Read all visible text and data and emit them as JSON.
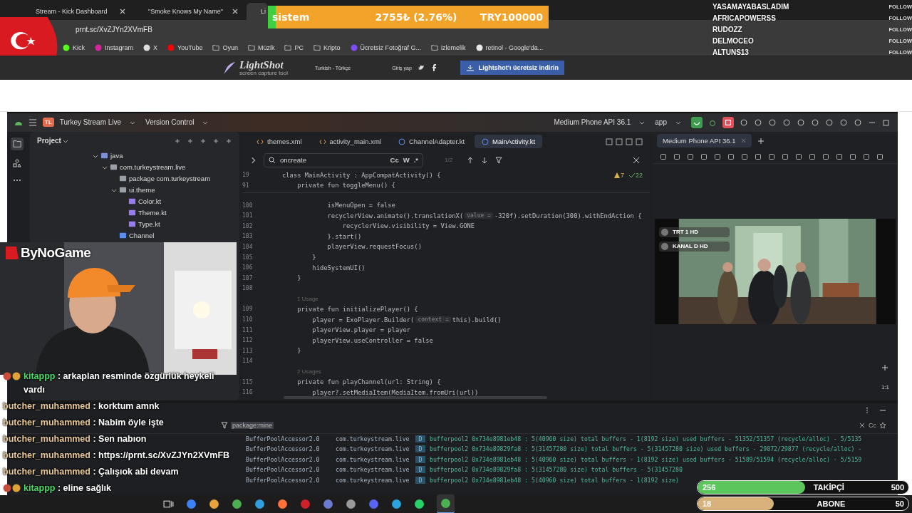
{
  "browser": {
    "tabs": [
      {
        "title": "Stream - Kick Dashboard",
        "selected": false
      },
      {
        "title": "\"Smoke Knows My Name\"",
        "selected": false
      },
      {
        "title": "Li",
        "selected": true
      }
    ],
    "address": "prnt.sc/XvZJYn2XVmFB",
    "bookmarks": [
      {
        "label": "Kick",
        "kind": "site",
        "color": "#53fc18"
      },
      {
        "label": "Instagram",
        "kind": "site",
        "color": "#d6249f"
      },
      {
        "label": "X",
        "kind": "site",
        "color": "#dddddd"
      },
      {
        "label": "YouTube",
        "kind": "site",
        "color": "#ff0000"
      },
      {
        "label": "Oyun",
        "kind": "folder"
      },
      {
        "label": "Müzik",
        "kind": "folder"
      },
      {
        "label": "PC",
        "kind": "folder"
      },
      {
        "label": "Kripto",
        "kind": "folder"
      },
      {
        "label": "Ücretsiz Fotoğraf G...",
        "kind": "site",
        "color": "#7b4dff"
      },
      {
        "label": "izlemelik",
        "kind": "folder"
      },
      {
        "label": "retinol - Google'da...",
        "kind": "site",
        "color": "#e8e8e8"
      }
    ]
  },
  "lightshot": {
    "logo": "LightShot",
    "tagline": "screen capture tool",
    "language": "Turkish - Türkçe",
    "login": "Giriş yap",
    "download": "Lightshot'ı ücretsiz indirin"
  },
  "ide": {
    "badge": "TL",
    "project_name": "Turkey Stream Live",
    "vcs": "Version Control",
    "device": "Medium Phone API 36.1",
    "run_config": "app",
    "project": {
      "title": "Project",
      "tree": [
        {
          "label": "java",
          "kind": "folder",
          "expanded": true,
          "children": [
            {
              "label": "com.turkeystream.live",
              "kind": "package",
              "expanded": true,
              "children": [
                {
                  "label": "package com.turkeystream",
                  "kind": "package"
                },
                {
                  "label": "ui.theme",
                  "kind": "package",
                  "expanded": true,
                  "children": [
                    {
                      "label": "Color.kt",
                      "kind": "kotlin"
                    },
                    {
                      "label": "Theme.kt",
                      "kind": "kotlin"
                    },
                    {
                      "label": "Type.kt",
                      "kind": "kotlin"
                    }
                  ]
                },
                {
                  "label": "Channel",
                  "kind": "class"
                }
              ]
            }
          ]
        }
      ]
    },
    "editor": {
      "tabs": [
        {
          "label": "themes.xml",
          "kind": "xml",
          "selected": false
        },
        {
          "label": "activity_main.xml",
          "kind": "xml",
          "selected": false
        },
        {
          "label": "ChannelAdapter.kt",
          "kind": "class",
          "selected": false
        },
        {
          "label": "MainActivity.kt",
          "kind": "class",
          "selected": true
        }
      ],
      "search": {
        "value": "oncreate",
        "options": [
          "Cc",
          "W",
          ".*"
        ],
        "count": "1/2"
      },
      "warnings": "7",
      "passed": "22",
      "sticky": [
        {
          "num": "19",
          "text": "class MainActivity : AppCompatActivity() {"
        },
        {
          "num": "91",
          "text": "    private fun toggleMenu() {"
        }
      ],
      "lines": [
        {
          "kind": "line",
          "num": "100",
          "parts": [
            {
              "kind": "code",
              "text": "            isMenuOpen = false"
            }
          ]
        },
        {
          "kind": "line",
          "num": "101",
          "parts": [
            {
              "kind": "code",
              "text": "            recyclerView.animate().translationX("
            },
            {
              "kind": "hint",
              "text": "value ="
            },
            {
              "kind": "code",
              "text": "-320f).setDuration(300).withEndAction {"
            }
          ]
        },
        {
          "kind": "line",
          "num": "102",
          "parts": [
            {
              "kind": "code",
              "text": "                recyclerView.visibility = View.GONE"
            }
          ]
        },
        {
          "kind": "line",
          "num": "103",
          "parts": [
            {
              "kind": "code",
              "text": "            }.start()"
            }
          ]
        },
        {
          "kind": "line",
          "num": "104",
          "parts": [
            {
              "kind": "code",
              "text": "            playerView.requestFocus()"
            }
          ]
        },
        {
          "kind": "line",
          "num": "105",
          "parts": [
            {
              "kind": "code",
              "text": "        }"
            }
          ]
        },
        {
          "kind": "line",
          "num": "106",
          "parts": [
            {
              "kind": "code",
              "text": "        hideSystemUI()"
            }
          ]
        },
        {
          "kind": "line",
          "num": "107",
          "parts": [
            {
              "kind": "code",
              "text": "    }"
            }
          ]
        },
        {
          "kind": "line",
          "num": "108"
        },
        {
          "kind": "usage",
          "text": "1 Usage"
        },
        {
          "kind": "line",
          "num": "109",
          "parts": [
            {
              "kind": "code",
              "text": "    private fun initializePlayer() {"
            }
          ]
        },
        {
          "kind": "line",
          "num": "110",
          "parts": [
            {
              "kind": "code",
              "text": "        player = ExoPlayer.Builder("
            },
            {
              "kind": "hint",
              "text": "context ="
            },
            {
              "kind": "code",
              "text": "this).build()"
            }
          ]
        },
        {
          "kind": "line",
          "num": "111",
          "parts": [
            {
              "kind": "code",
              "text": "        playerView.player = player"
            }
          ]
        },
        {
          "kind": "line",
          "num": "112",
          "parts": [
            {
              "kind": "code",
              "text": "        playerView.useController = false"
            }
          ]
        },
        {
          "kind": "line",
          "num": "113",
          "parts": [
            {
              "kind": "code",
              "text": "    }"
            }
          ]
        },
        {
          "kind": "line",
          "num": "114"
        },
        {
          "kind": "usage",
          "text": "2 Usages"
        },
        {
          "kind": "line",
          "num": "115",
          "parts": [
            {
              "kind": "code",
              "text": "    private fun playChannel(url: String) {"
            }
          ]
        },
        {
          "kind": "line",
          "num": "116",
          "parts": [
            {
              "kind": "code",
              "text": "        player?.setMediaItem(MediaItem.fromUri(url))"
            }
          ]
        }
      ]
    },
    "emulator": {
      "tab": "Medium Phone API 36.1",
      "channels": [
        "TRT 1 HD",
        "KANAL D HD"
      ],
      "zoom": "1:1"
    },
    "logcat": {
      "filter": "package:mine",
      "filter_option": "Cc",
      "rows": [
        {
          "tag": "BufferPoolAccessor2.0",
          "package": "com.turkeystream.live",
          "level": "D",
          "message": "bufferpool2 0x734e8981eb48 : 5(40960 size) total buffers - 1(8192 size) used buffers - 51352/51357 (recycle/alloc) - 5/5135"
        },
        {
          "tag": "BufferPoolAccessor2.0",
          "package": "com.turkeystream.live",
          "level": "D",
          "message": "bufferpool2 0x734e89829fa8 : 5(31457280 size) total buffers - 5(31457280 size) used buffers - 29872/29877 (recycle/alloc) -"
        },
        {
          "tag": "BufferPoolAccessor2.0",
          "package": "com.turkeystream.live",
          "level": "D",
          "message": "bufferpool2 0x734e8981eb48 : 5(40960 size) total buffers - 1(8192 size) used buffers - 51589/51594 (recycle/alloc) - 5/5159"
        },
        {
          "tag": "BufferPoolAccessor2.0",
          "package": "com.turkeystream.live",
          "level": "D",
          "message": "bufferpool2 0x734e89829fa8 : 5(31457280 size) total buffers - 5(31457280"
        },
        {
          "tag": "BufferPoolAccessor2.0",
          "package": "com.turkeystream.live",
          "level": "D",
          "message": "bufferpool2 0x734e8981eb48 : 5(40960 size) total buffers - 1(8192 size)"
        }
      ]
    }
  },
  "overlays": {
    "ticker": {
      "label": "sistem",
      "amount": "2755₺ (2.76%)",
      "goal": "TRY100000",
      "level": 0.0276
    },
    "followers": [
      {
        "name": "YASAMAYABASLADIM",
        "action": "FOLLOW"
      },
      {
        "name": "AFRICAPOWERSS",
        "action": "FOLLOW"
      },
      {
        "name": "RUDOZZ",
        "action": "FOLLOW"
      },
      {
        "name": "DELMOCEO",
        "action": "FOLLOW"
      },
      {
        "name": "ALTUNS13",
        "action": "FOLLOW"
      }
    ],
    "webcam": {
      "logo": "ByNoGame"
    },
    "chat": [
      {
        "user": "kitappp",
        "color": "#4cd964",
        "text": ": arkaplan resminde özgürlük heykeli vardı",
        "badges": true
      },
      {
        "user": "butcher_muhammed",
        "color": "#e9c99a",
        "text": ": korktum amnk",
        "badges": false
      },
      {
        "user": "butcher_muhammed",
        "color": "#e9c99a",
        "text": ": Nabim öyle işte",
        "badges": false
      },
      {
        "user": "butcher_muhammed",
        "color": "#e9c99a",
        "text": ": Sen nabıon",
        "badges": false
      },
      {
        "user": "butcher_muhammed",
        "color": "#e9c99a",
        "text": ": https://prnt.sc/XvZJYn2XVmFB",
        "badges": false
      },
      {
        "user": "butcher_muhammed",
        "color": "#e9c99a",
        "text": ": Çalışıok abi devam",
        "badges": false
      },
      {
        "user": "kitappp",
        "color": "#4cd964",
        "text": ": eline sağlık",
        "badges": true
      }
    ],
    "goals": [
      {
        "current": "256",
        "label": "TAKİPÇİ",
        "target": "500",
        "level": 0.51,
        "color": "#5cc55c"
      },
      {
        "current": "18",
        "label": "ABONE",
        "target": "50",
        "level": 0.36,
        "color": "#d8b27a"
      }
    ]
  }
}
